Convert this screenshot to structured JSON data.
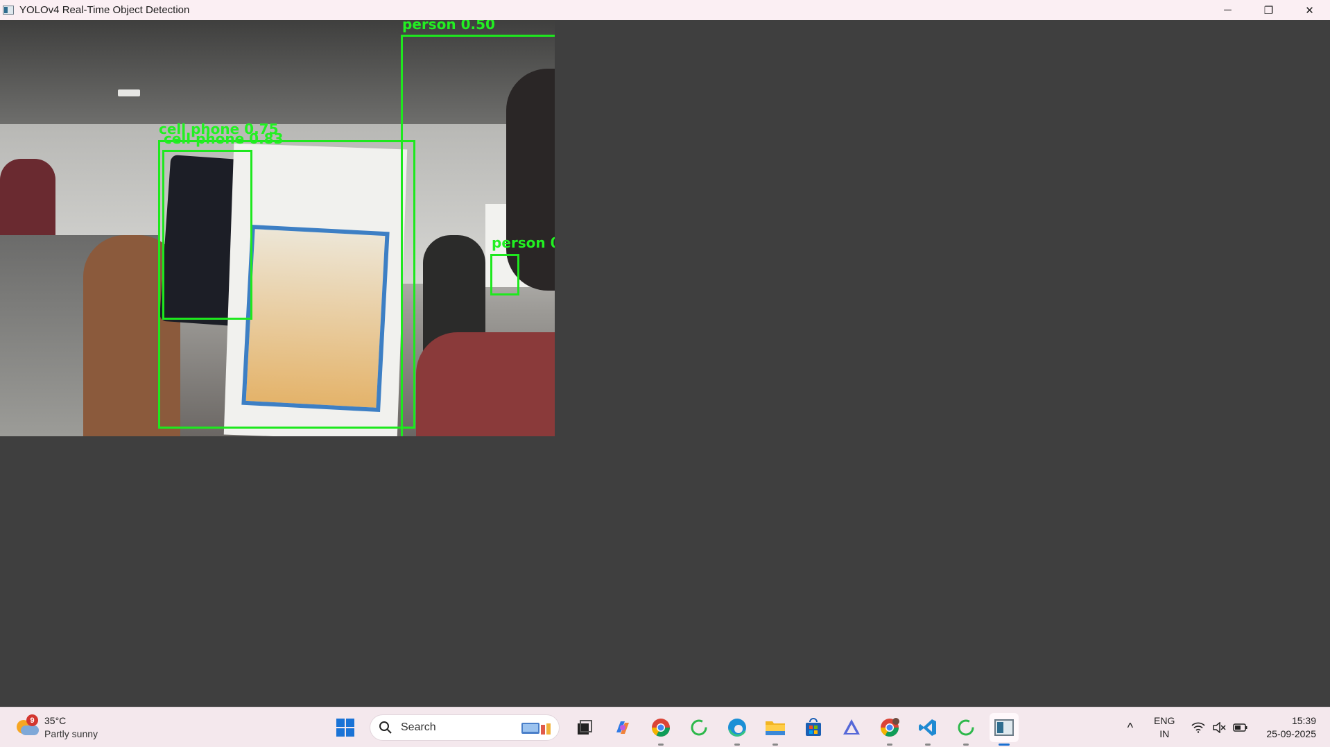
{
  "window": {
    "title": "YOLOv4 Real-Time Object Detection",
    "minimize_glyph": "─",
    "maximize_glyph": "❐",
    "close_glyph": "✕"
  },
  "detections": [
    {
      "label": "person 0.50"
    },
    {
      "label": "cell phone 0.75"
    },
    {
      "label": "cell phone 0.83"
    },
    {
      "label": "person 0"
    }
  ],
  "taskbar": {
    "weather": {
      "temp": "35°C",
      "condition": "Partly sunny",
      "badge": "9"
    },
    "search_label": "Search",
    "language": {
      "lang": "ENG",
      "region": "IN"
    },
    "clock": {
      "time": "15:39",
      "date": "25-09-2025"
    },
    "chevron_glyph": "^",
    "apps": [
      "start-icon",
      "search",
      "task-view-icon",
      "copilot-icon",
      "chrome-icon",
      "loading-app-icon",
      "edge-icon",
      "file-explorer-icon",
      "store-icon",
      "arc-icon",
      "chrome-profile-icon",
      "vscode-icon",
      "loading-app-icon",
      "opencv-window-icon"
    ]
  },
  "colors": {
    "detection_box": "#1ee81e",
    "window_bg": "#3f3f3f",
    "titlebar_bg": "#fbeff3",
    "taskbar_bg": "#f4e8ed",
    "active_indicator": "#1a6fd1"
  }
}
